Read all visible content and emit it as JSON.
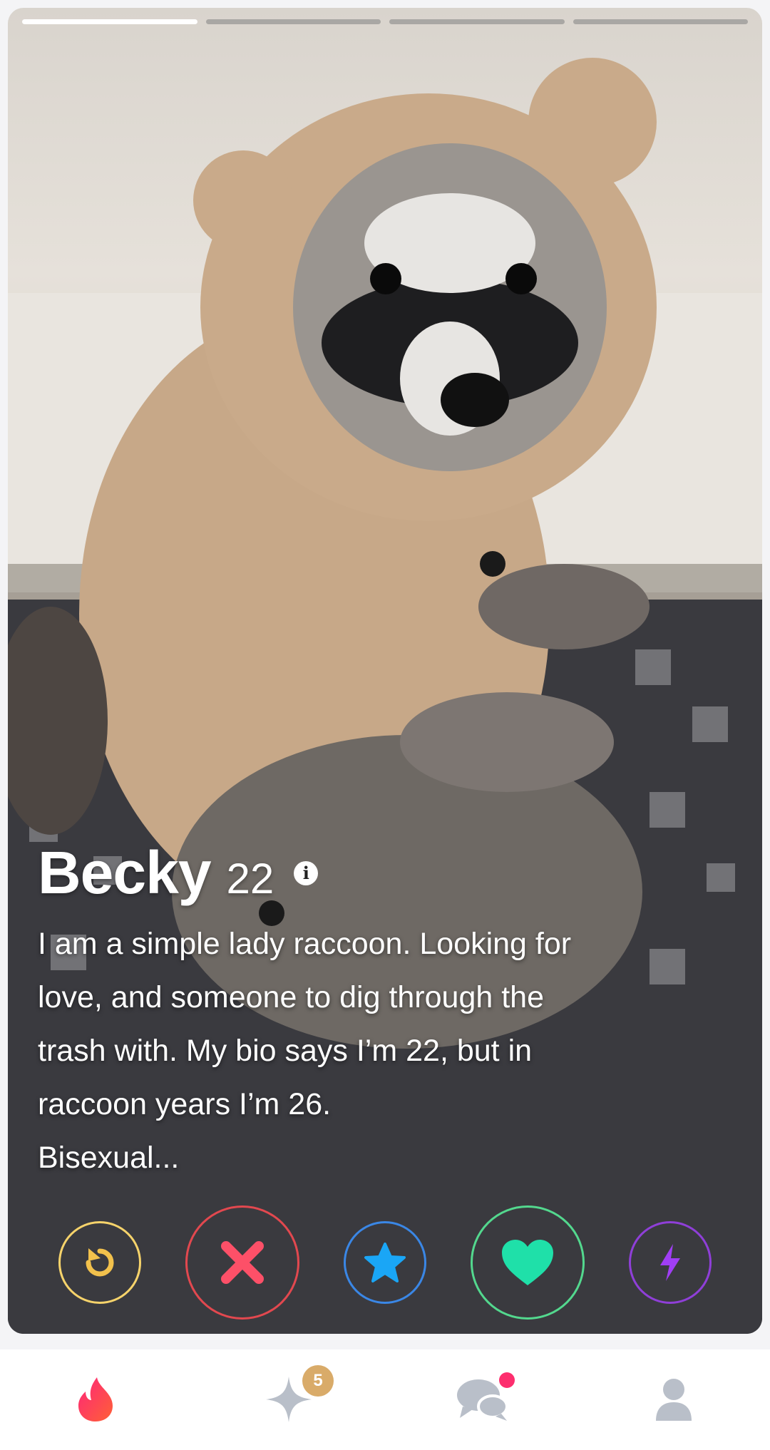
{
  "profile": {
    "name": "Becky",
    "age": "22",
    "bio_lines": [
      "I am a simple lady raccoon. Looking for",
      "love, and someone to dig through the",
      "trash with. My bio says I’m 22, but in",
      "raccoon years I’m 26.",
      "Bisexual..."
    ],
    "photo_count": 4,
    "active_photo": 1
  },
  "actions": [
    {
      "name": "rewind",
      "icon": "rewind-icon",
      "color": "#f6d36b"
    },
    {
      "name": "nope",
      "icon": "close-icon",
      "color": "#fd5068"
    },
    {
      "name": "super-like",
      "icon": "star-icon",
      "color": "#1aa6f6"
    },
    {
      "name": "like",
      "icon": "heart-icon",
      "color": "#1fe0a9"
    },
    {
      "name": "boost",
      "icon": "lightning-icon",
      "color": "#a03ef5"
    }
  ],
  "tabbar": {
    "items": [
      "flame-icon",
      "sparkle-icon",
      "chat-icon",
      "profile-icon"
    ],
    "sparkle_badge": "5",
    "accent": "#fd2e6e"
  }
}
